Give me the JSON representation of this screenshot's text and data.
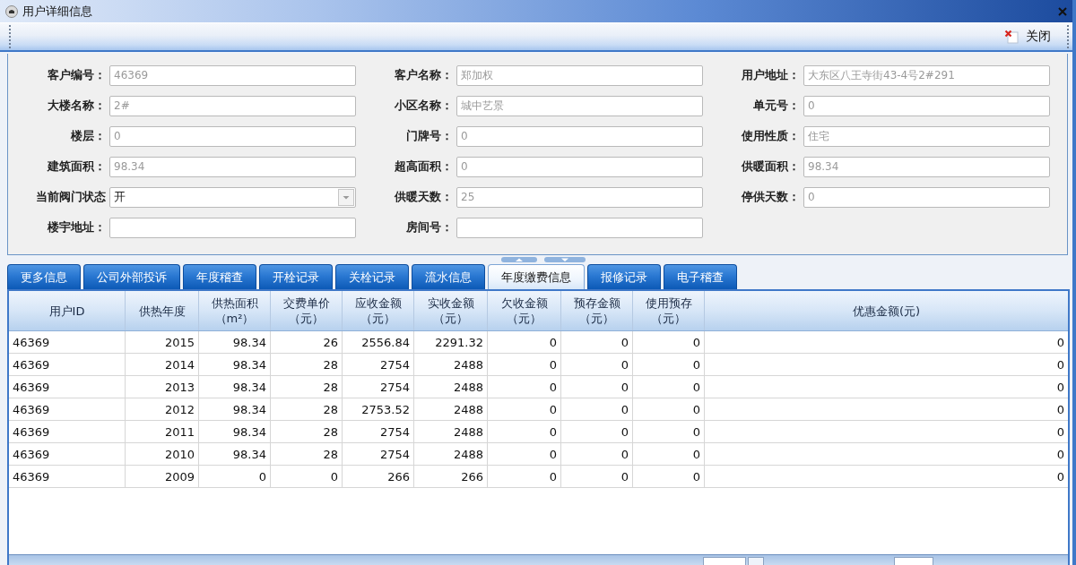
{
  "window": {
    "title": "用户详细信息"
  },
  "toolbar": {
    "close_button": "关闭"
  },
  "form": {
    "rows": [
      [
        {
          "label": "客户编号：",
          "kind": "text",
          "value": "46369",
          "disabled": true
        },
        {
          "label": "客户名称：",
          "kind": "text",
          "value": "郑加权",
          "disabled": true
        },
        {
          "label": "用户地址：",
          "kind": "text",
          "value": "大东区八王寺街43-4号2#291",
          "disabled": true
        }
      ],
      [
        {
          "label": "大楼名称：",
          "kind": "text",
          "value": "2#",
          "disabled": true
        },
        {
          "label": "小区名称：",
          "kind": "text",
          "value": "城中艺景",
          "disabled": true
        },
        {
          "label": "单元号：",
          "kind": "text",
          "value": "0",
          "disabled": true
        }
      ],
      [
        {
          "label": "楼层：",
          "kind": "text",
          "value": "0",
          "disabled": true
        },
        {
          "label": "门牌号：",
          "kind": "text",
          "value": "0",
          "disabled": true
        },
        {
          "label": "使用性质：",
          "kind": "text",
          "value": "住宅",
          "disabled": true
        }
      ],
      [
        {
          "label": "建筑面积：",
          "kind": "text",
          "value": "98.34",
          "disabled": true
        },
        {
          "label": "超高面积：",
          "kind": "text",
          "value": "0",
          "disabled": true
        },
        {
          "label": "供暖面积：",
          "kind": "text",
          "value": "98.34",
          "disabled": true
        }
      ],
      [
        {
          "label": "当前阀门状态",
          "kind": "select",
          "value": "开",
          "disabled": false
        },
        {
          "label": "供暖天数：",
          "kind": "text",
          "value": "25",
          "disabled": true
        },
        {
          "label": "停供天数：",
          "kind": "text",
          "value": "0",
          "disabled": true
        }
      ],
      [
        {
          "label": "楼宇地址：",
          "kind": "text"
        },
        {
          "label": "房间号：",
          "kind": "text"
        }
      ]
    ]
  },
  "tabs": [
    {
      "label": "更多信息",
      "selected": false
    },
    {
      "label": "公司外部投诉",
      "selected": false
    },
    {
      "label": "年度稽查",
      "selected": false
    },
    {
      "label": "开栓记录",
      "selected": false
    },
    {
      "label": "关栓记录",
      "selected": false
    },
    {
      "label": "流水信息",
      "selected": false
    },
    {
      "label": "年度缴费信息",
      "selected": true
    },
    {
      "label": "报修记录",
      "selected": false
    },
    {
      "label": "电子稽查",
      "selected": false
    }
  ],
  "table": {
    "columns": [
      {
        "label": "用户ID"
      },
      {
        "label": "供热年度"
      },
      {
        "label": "供热面积",
        "unit": "（m²）"
      },
      {
        "label": "交费单价",
        "unit": "（元）"
      },
      {
        "label": "应收金额",
        "unit": "（元）"
      },
      {
        "label": "实收金额",
        "unit": "（元）"
      },
      {
        "label": "欠收金额",
        "unit": "（元）"
      },
      {
        "label": "预存金额",
        "unit": "（元）"
      },
      {
        "label": "使用预存",
        "unit": "（元）"
      },
      {
        "label": "优惠金额(元)"
      }
    ],
    "rows": [
      [
        "46369",
        "2015",
        "98.34",
        "26",
        "2556.84",
        "2291.32",
        "0",
        "0",
        "0",
        "0"
      ],
      [
        "46369",
        "2014",
        "98.34",
        "28",
        "2754",
        "2488",
        "0",
        "0",
        "0",
        "0"
      ],
      [
        "46369",
        "2013",
        "98.34",
        "28",
        "2754",
        "2488",
        "0",
        "0",
        "0",
        "0"
      ],
      [
        "46369",
        "2012",
        "98.34",
        "28",
        "2753.52",
        "2488",
        "0",
        "0",
        "0",
        "0"
      ],
      [
        "46369",
        "2011",
        "98.34",
        "28",
        "2754",
        "2488",
        "0",
        "0",
        "0",
        "0"
      ],
      [
        "46369",
        "2010",
        "98.34",
        "28",
        "2754",
        "2488",
        "0",
        "0",
        "0",
        "0"
      ],
      [
        "46369",
        "2009",
        "0",
        "0",
        "266",
        "266",
        "0",
        "0",
        "0",
        "0"
      ]
    ]
  }
}
